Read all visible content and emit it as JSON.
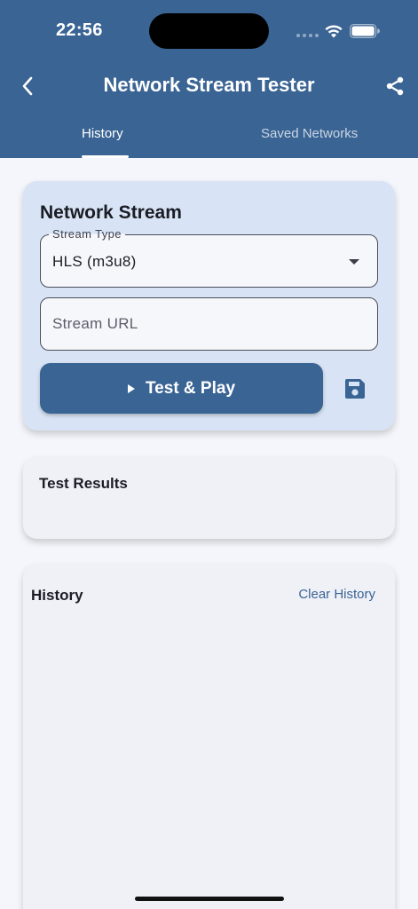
{
  "status_bar": {
    "time": "22:56"
  },
  "nav": {
    "title": "Network Stream Tester"
  },
  "tabs": [
    {
      "label": "History",
      "active": true
    },
    {
      "label": "Saved Networks",
      "active": false
    }
  ],
  "stream_card": {
    "title": "Network Stream",
    "stream_type": {
      "label": "Stream Type",
      "value": "HLS (m3u8)"
    },
    "url_field": {
      "placeholder": "Stream URL",
      "value": ""
    },
    "play_button": {
      "label": "Test & Play"
    }
  },
  "results": {
    "title": "Test Results"
  },
  "history": {
    "title": "History",
    "clear_label": "Clear History"
  },
  "icons": {
    "back": "chevron-left-icon",
    "share": "share-icon",
    "play": "play-icon",
    "save": "floppy-disk-icon",
    "dropdown": "caret-down-icon"
  },
  "colors": {
    "primary": "#3a6494",
    "card_primary": "#d8e4f5",
    "card_surface": "#f0f1f7",
    "background": "#f5f6fb"
  }
}
